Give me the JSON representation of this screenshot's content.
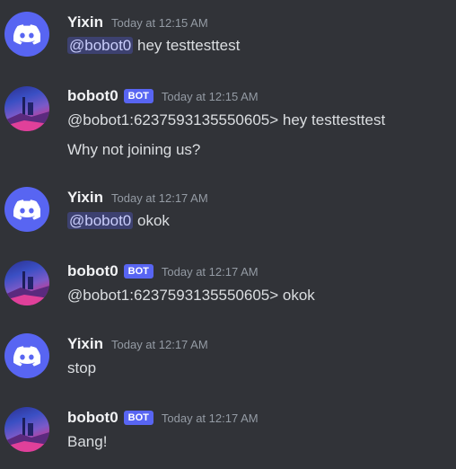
{
  "messages": [
    {
      "author": "Yixin",
      "timestamp": "Today at 12:15 AM",
      "mention": "@bobot0",
      "text": " hey testtesttest"
    },
    {
      "author": "bobot0",
      "badge": "BOT",
      "timestamp": "Today at 12:15 AM",
      "lines": [
        "@bobot1:6237593135550605> hey testtesttest",
        "Why not joining us?"
      ]
    },
    {
      "author": "Yixin",
      "timestamp": "Today at 12:17 AM",
      "mention": "@bobot0",
      "text": " okok"
    },
    {
      "author": "bobot0",
      "badge": "BOT",
      "timestamp": "Today at 12:17 AM",
      "lines": [
        "@bobot1:6237593135550605> okok"
      ]
    },
    {
      "author": "Yixin",
      "timestamp": "Today at 12:17 AM",
      "lines": [
        "stop"
      ]
    },
    {
      "author": "bobot0",
      "badge": "BOT",
      "timestamp": "Today at 12:17 AM",
      "lines": [
        "Bang!"
      ]
    }
  ],
  "colors": {
    "background": "#313338",
    "discord_blurple": "#5865f2",
    "timestamp": "#949ba4",
    "text": "#dbdee1"
  },
  "icons": {
    "user_avatar": "discord-logo-icon",
    "bot_avatar": "bot-avatar-image"
  }
}
